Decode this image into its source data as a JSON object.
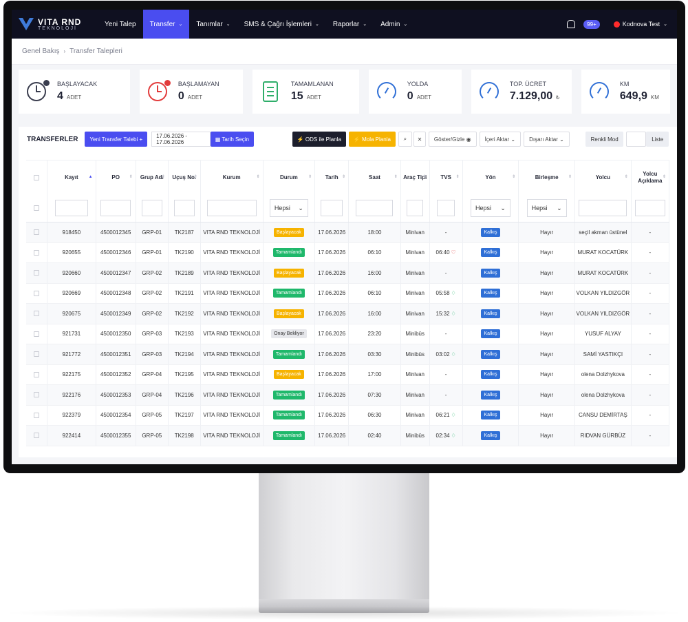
{
  "brand": {
    "title": "VITA RND",
    "subtitle": "TEKNOLOJİ"
  },
  "nav": {
    "items": [
      {
        "label": "Yeni Talep",
        "caret": false,
        "active": false
      },
      {
        "label": "Transfer",
        "caret": true,
        "active": true
      },
      {
        "label": "Tanımlar",
        "caret": true,
        "active": false
      },
      {
        "label": "SMS & Çağrı İşlemleri",
        "caret": true,
        "active": false
      },
      {
        "label": "Raporlar",
        "caret": true,
        "active": false
      },
      {
        "label": "Admin",
        "caret": true,
        "active": false
      }
    ],
    "notification_count": "99+",
    "user": "Kodnova Test"
  },
  "breadcrumb": {
    "home": "Genel Bakış",
    "current": "Transfer Talepleri"
  },
  "cards": [
    {
      "label": "BAŞLAYACAK",
      "value": "4",
      "unit": "ADET",
      "icon": "clock-icon"
    },
    {
      "label": "BAŞLAMAYAN",
      "value": "0",
      "unit": "ADET",
      "icon": "alarm-clock-icon"
    },
    {
      "label": "TAMAMLANAN",
      "value": "15",
      "unit": "ADET",
      "icon": "clipboard-check-icon"
    },
    {
      "label": "YOLDA",
      "value": "0",
      "unit": "ADET",
      "icon": "speedometer-icon"
    },
    {
      "label": "TOP. ÜCRET",
      "value": "7.129,00",
      "unit": "₺",
      "icon": "speedometer-icon"
    },
    {
      "label": "KM",
      "value": "649,9",
      "unit": "KM",
      "icon": "speedometer-icon"
    }
  ],
  "toolbar": {
    "title": "TRANSFERLER",
    "new_button": "Yeni Transfer Talebi +",
    "date_range": "17.06.2026 - 17.06.2026",
    "date_button": "▦ Tarih Seçin",
    "ods_button": "⚡ ODS ile Planla",
    "mola_button": "⚡ Mola Planla",
    "show_hide": "Göster/Gizle ◉",
    "import": "İçeri Aktar ⌄",
    "export": "Dışarı Aktar ⌄",
    "color_mode": "Renkli Mod",
    "list": "Liste"
  },
  "table": {
    "columns": [
      "Kayıt",
      "PO",
      "Grup Adı",
      "Uçuş No.",
      "Kurum",
      "Durum",
      "Tarih",
      "Saat",
      "Araç Tipi",
      "TVS",
      "Yön",
      "Birleşme",
      "Yolcu",
      "Yolcu Açıklama"
    ],
    "filter_select": "Hepsi",
    "rows": [
      {
        "kayit": "918450",
        "po": "4500012345",
        "grup": "GRP-01",
        "ucus": "TK2187",
        "kurum": "VITA RND TEKNOLOJİ",
        "durum": "Başlayacak",
        "durum_color": "yellow",
        "tarih": "17.06.2026",
        "saat": "18:00",
        "arac": "Minivan",
        "tvs": "-",
        "tvs_icon": "",
        "yon": "Kalkış",
        "birlesme": "Hayır",
        "yolcu": "seçil akman üstünel",
        "aciklama": "-"
      },
      {
        "kayit": "920655",
        "po": "4500012346",
        "grup": "GRP-01",
        "ucus": "TK2190",
        "kurum": "VITA RND TEKNOLOJİ",
        "durum": "Tamamlandı",
        "durum_color": "green",
        "tarih": "17.06.2026",
        "saat": "06:10",
        "arac": "Minivan",
        "tvs": "06:40",
        "tvs_icon": "♡",
        "yon": "Kalkış",
        "birlesme": "Hayır",
        "yolcu": "MURAT KOCATÜRK",
        "aciklama": "-"
      },
      {
        "kayit": "920660",
        "po": "4500012347",
        "grup": "GRP-02",
        "ucus": "TK2189",
        "kurum": "VITA RND TEKNOLOJİ",
        "durum": "Başlayacak",
        "durum_color": "yellow",
        "tarih": "17.06.2026",
        "saat": "16:00",
        "arac": "Minivan",
        "tvs": "-",
        "tvs_icon": "",
        "yon": "Kalkış",
        "birlesme": "Hayır",
        "yolcu": "MURAT KOCATÜRK",
        "aciklama": "-"
      },
      {
        "kayit": "920669",
        "po": "4500012348",
        "grup": "GRP-02",
        "ucus": "TK2191",
        "kurum": "VITA RND TEKNOLOJİ",
        "durum": "Tamamlandı",
        "durum_color": "green",
        "tarih": "17.06.2026",
        "saat": "06:10",
        "arac": "Minivan",
        "tvs": "05:58",
        "tvs_icon": "♢",
        "yon": "Kalkış",
        "birlesme": "Hayır",
        "yolcu": "VOLKAN YILDIZGÖR",
        "aciklama": "-"
      },
      {
        "kayit": "920675",
        "po": "4500012349",
        "grup": "GRP-02",
        "ucus": "TK2192",
        "kurum": "VITA RND TEKNOLOJİ",
        "durum": "Başlayacak",
        "durum_color": "yellow",
        "tarih": "17.06.2026",
        "saat": "16:00",
        "arac": "Minivan",
        "tvs": "15:32",
        "tvs_icon": "♢",
        "yon": "Kalkış",
        "birlesme": "Hayır",
        "yolcu": "VOLKAN YILDIZGÖR",
        "aciklama": "-"
      },
      {
        "kayit": "921731",
        "po": "4500012350",
        "grup": "GRP-03",
        "ucus": "TK2193",
        "kurum": "VITA RND TEKNOLOJİ",
        "durum": "Onay Bekliyor",
        "durum_color": "grey",
        "tarih": "17.06.2026",
        "saat": "23:20",
        "arac": "Minibüs",
        "tvs": "-",
        "tvs_icon": "",
        "yon": "Kalkış",
        "birlesme": "Hayır",
        "yolcu": "YUSUF ALYAY",
        "aciklama": "-"
      },
      {
        "kayit": "921772",
        "po": "4500012351",
        "grup": "GRP-03",
        "ucus": "TK2194",
        "kurum": "VITA RND TEKNOLOJİ",
        "durum": "Tamamlandı",
        "durum_color": "green",
        "tarih": "17.06.2026",
        "saat": "03:30",
        "arac": "Minibüs",
        "tvs": "03:02",
        "tvs_icon": "♢",
        "yon": "Kalkış",
        "birlesme": "Hayır",
        "yolcu": "SAMİ YASTIKÇI",
        "aciklama": "-"
      },
      {
        "kayit": "922175",
        "po": "4500012352",
        "grup": "GRP-04",
        "ucus": "TK2195",
        "kurum": "VITA RND TEKNOLOJİ",
        "durum": "Başlayacak",
        "durum_color": "yellow",
        "tarih": "17.06.2026",
        "saat": "17:00",
        "arac": "Minivan",
        "tvs": "-",
        "tvs_icon": "",
        "yon": "Kalkış",
        "birlesme": "Hayır",
        "yolcu": "olena Dolzhykova",
        "aciklama": "-"
      },
      {
        "kayit": "922176",
        "po": "4500012353",
        "grup": "GRP-04",
        "ucus": "TK2196",
        "kurum": "VITA RND TEKNOLOJİ",
        "durum": "Tamamlandı",
        "durum_color": "green",
        "tarih": "17.06.2026",
        "saat": "07:30",
        "arac": "Minivan",
        "tvs": "-",
        "tvs_icon": "",
        "yon": "Kalkış",
        "birlesme": "Hayır",
        "yolcu": "olena Dolzhykova",
        "aciklama": "-"
      },
      {
        "kayit": "922379",
        "po": "4500012354",
        "grup": "GRP-05",
        "ucus": "TK2197",
        "kurum": "VITA RND TEKNOLOJİ",
        "durum": "Tamamlandı",
        "durum_color": "green",
        "tarih": "17.06.2026",
        "saat": "06:30",
        "arac": "Minivan",
        "tvs": "06:21",
        "tvs_icon": "♢",
        "yon": "Kalkış",
        "birlesme": "Hayır",
        "yolcu": "CANSU DEMİRTAŞ",
        "aciklama": "-"
      },
      {
        "kayit": "922414",
        "po": "4500012355",
        "grup": "GRP-05",
        "ucus": "TK2198",
        "kurum": "VITA RND TEKNOLOJİ",
        "durum": "Tamamlandı",
        "durum_color": "green",
        "tarih": "17.06.2026",
        "saat": "02:40",
        "arac": "Minibüs",
        "tvs": "02:34",
        "tvs_icon": "♢",
        "yon": "Kalkış",
        "birlesme": "Hayır",
        "yolcu": "RIDVAN GÜRBÜZ",
        "aciklama": "-"
      }
    ]
  },
  "colors": {
    "accent": "#4a4df0",
    "nav_bg": "#0f1020",
    "status_yellow": "#f6b300",
    "status_green": "#1fb86b",
    "direction_blue": "#2f6fd6"
  }
}
